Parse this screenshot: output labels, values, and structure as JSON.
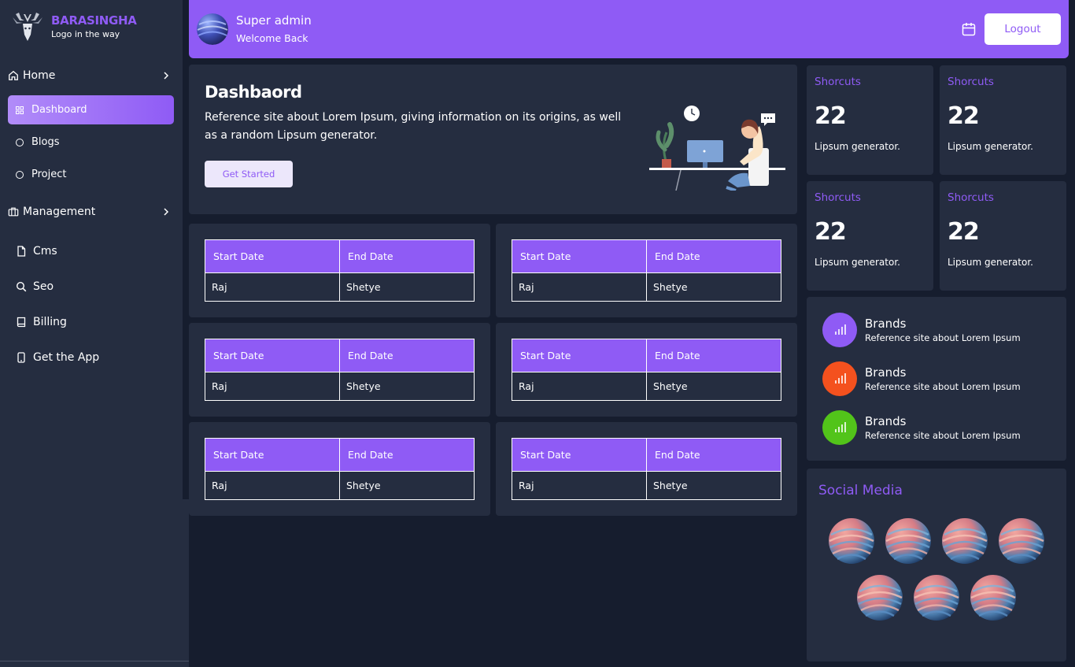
{
  "brand": {
    "title": "BARASINGHA",
    "subtitle": "Logo in the way"
  },
  "sidebar": {
    "home": {
      "label": "Home",
      "icon": "home-icon"
    },
    "sub_items": [
      {
        "label": "Dashboard",
        "active": true
      },
      {
        "label": "Blogs",
        "active": false
      },
      {
        "label": "Project",
        "active": false
      }
    ],
    "management": {
      "label": "Management",
      "icon": "briefcase-icon"
    },
    "items": [
      {
        "label": "Cms",
        "icon": "file-icon"
      },
      {
        "label": "Seo",
        "icon": "search-icon"
      },
      {
        "label": "Billing",
        "icon": "book-icon"
      },
      {
        "label": "Get the App",
        "icon": "mobile-icon"
      }
    ]
  },
  "header": {
    "user_name": "Super admin",
    "user_sub": "Welcome Back",
    "logout_label": "Logout",
    "calendar_icon": "calendar-icon"
  },
  "hero": {
    "title": "Dashbaord",
    "text": "Reference site about Lorem Ipsum, giving information on its origins, as well as a random Lipsum generator.",
    "button_label": "Get Started"
  },
  "tables": [
    {
      "headers": [
        "Start Date",
        "End Date"
      ],
      "row": [
        "Raj",
        "Shetye"
      ]
    },
    {
      "headers": [
        "Start Date",
        "End Date"
      ],
      "row": [
        "Raj",
        "Shetye"
      ]
    },
    {
      "headers": [
        "Start Date",
        "End Date"
      ],
      "row": [
        "Raj",
        "Shetye"
      ]
    },
    {
      "headers": [
        "Start Date",
        "End Date"
      ],
      "row": [
        "Raj",
        "Shetye"
      ]
    },
    {
      "headers": [
        "Start Date",
        "End Date"
      ],
      "row": [
        "Raj",
        "Shetye"
      ]
    },
    {
      "headers": [
        "Start Date",
        "End Date"
      ],
      "row": [
        "Raj",
        "Shetye"
      ]
    }
  ],
  "shortcuts": [
    {
      "label": "Shorcuts",
      "value": "22",
      "sub": "Lipsum generator."
    },
    {
      "label": "Shorcuts",
      "value": "22",
      "sub": "Lipsum generator."
    },
    {
      "label": "Shorcuts",
      "value": "22",
      "sub": "Lipsum generator."
    },
    {
      "label": "Shorcuts",
      "value": "22",
      "sub": "Lipsum generator."
    }
  ],
  "brands": [
    {
      "name": "Brands",
      "desc": "Reference site about Lorem Ipsum",
      "color": "#8f5bf5",
      "icon": "bar-chart-icon"
    },
    {
      "name": "Brands",
      "desc": "Reference site about Lorem Ipsum",
      "color": "#f4511e",
      "icon": "bar-chart-icon"
    },
    {
      "name": "Brands",
      "desc": "Reference site about Lorem Ipsum",
      "color": "#52c41a",
      "icon": "bar-chart-icon"
    }
  ],
  "social": {
    "title": "Social Media",
    "count": 7
  },
  "colors": {
    "accent": "#8f5bf5",
    "sidebar_bg": "#252d40",
    "page_bg": "#161d2e",
    "card_bg": "#252d40"
  }
}
